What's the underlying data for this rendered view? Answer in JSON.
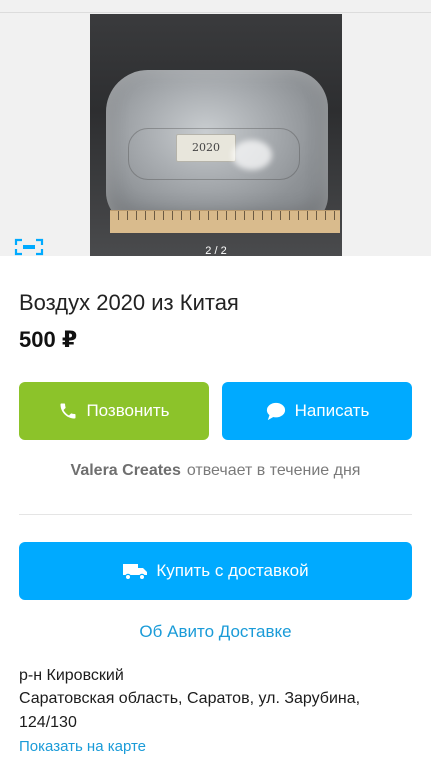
{
  "gallery": {
    "photo_label": "2020",
    "pager": "2 / 2"
  },
  "listing": {
    "title": "Воздух 2020 из Китая",
    "price": "500 ₽"
  },
  "actions": {
    "call_label": "Позвонить",
    "write_label": "Написать",
    "buy_label": "Купить с доставкой",
    "delivery_info_label": "Об Авито Доставке"
  },
  "seller": {
    "name": "Valera Creates",
    "response_time": "отвечает в течение дня"
  },
  "location": {
    "district": "р-н Кировский",
    "address_line1": "Саратовская область, Саратов, ул. Зарубина,",
    "address_line2": "124/130",
    "map_link": "Показать на карте"
  },
  "colors": {
    "call_button": "#8cc32a",
    "accent": "#00aaff",
    "link": "#1a9bd8"
  },
  "icons": [
    "phone-icon",
    "chat-bubble-icon",
    "truck-icon",
    "scan-icon"
  ]
}
